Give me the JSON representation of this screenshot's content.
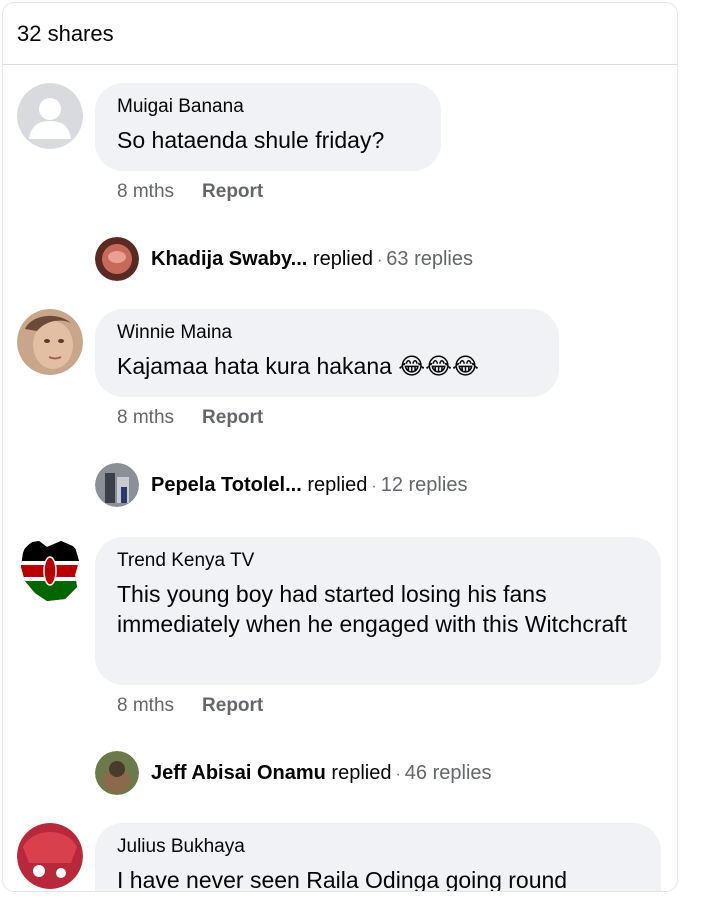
{
  "header": {
    "shares": "32 shares"
  },
  "comments": [
    {
      "author": "Muigai Banana",
      "text": "So hataenda shule friday?",
      "time": "8 mths",
      "report": "Report",
      "reply": {
        "name": "Khadija Swaby...",
        "action": "replied",
        "sep": "·",
        "count": "63 replies"
      }
    },
    {
      "author": "Winnie Maina",
      "text": "Kajamaa hata kura hakana 😂😂😂",
      "time": "8 mths",
      "report": "Report",
      "reply": {
        "name": "Pepela Totolel...",
        "action": "replied",
        "sep": "·",
        "count": "12 replies"
      }
    },
    {
      "author": "Trend Kenya TV",
      "text": "This young boy had started losing his fans immediately when he engaged with this Witchcraft",
      "time": "8 mths",
      "report": "Report",
      "reply": {
        "name": "Jeff Abisai Onamu",
        "action": "replied",
        "sep": "·",
        "count": "46 replies"
      }
    },
    {
      "author": "Julius Bukhaya",
      "text": "I have never seen Raila Odinga going round"
    }
  ]
}
